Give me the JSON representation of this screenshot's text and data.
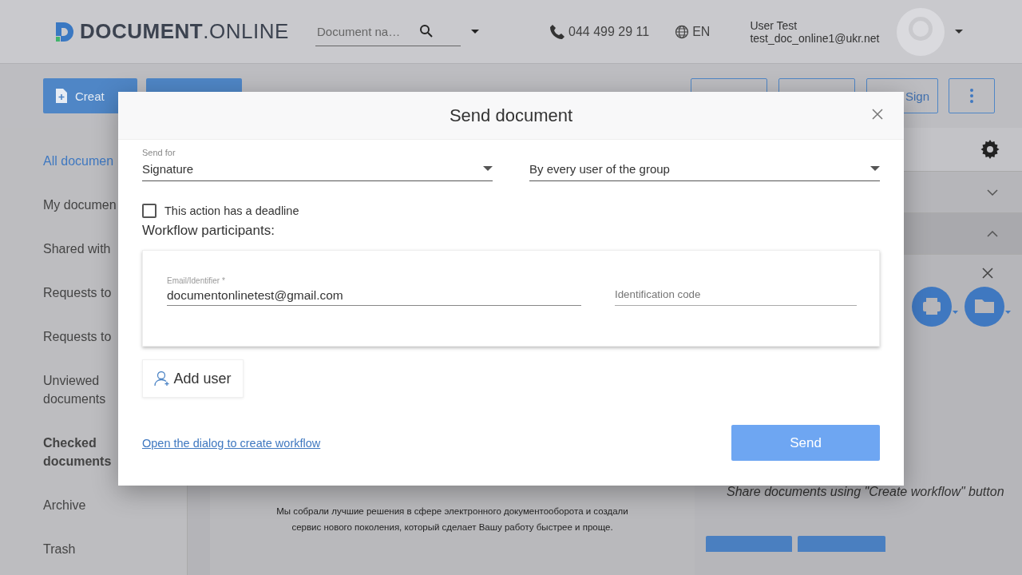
{
  "header": {
    "logo": "**DOCUMENT**.ONLINE",
    "search": {
      "placeholder": "Document na…"
    },
    "phone": "044 499 29 11",
    "language": "EN",
    "user": {
      "name": "User Test",
      "email": "test_doc_online1@ukr.net"
    }
  },
  "toolbar": {
    "left_buttons": [
      {
        "kind": "create",
        "label": "Creat"
      },
      {
        "kind": "blank"
      }
    ],
    "right_buttons": [
      {
        "kind": "outline"
      },
      {
        "kind": "outline"
      },
      {
        "kind": "sign",
        "label": "Sign"
      },
      {
        "kind": "more"
      }
    ]
  },
  "sidebar": {
    "items": [
      {
        "label": "All documen",
        "selected": true,
        "bold": false
      },
      {
        "label": "My documen",
        "selected": false,
        "bold": false
      },
      {
        "label": "Shared with",
        "selected": false,
        "bold": false
      },
      {
        "label": "Requests to",
        "selected": false,
        "bold": false
      },
      {
        "label": "Requests to",
        "selected": false,
        "bold": false
      },
      {
        "label": "Unviewed documents",
        "selected": false,
        "bold": false
      },
      {
        "label": "Checked documents",
        "selected": false,
        "bold": true
      },
      {
        "label": "Archive",
        "selected": false,
        "bold": false
      },
      {
        "label": "Trash",
        "selected": false,
        "bold": false
      }
    ]
  },
  "content": {
    "description": "Мы собрали лучшие решения в сфере электронного документооборота и создали сервис нового поколения, который сделает Вашу работу быстрее и проще."
  },
  "right_panel": {
    "sections": [
      {
        "expanded": false
      },
      {
        "expanded": true
      }
    ],
    "hint": "Share documents using \"Create workflow\" button"
  },
  "dialog": {
    "title": "Send document",
    "send_for": {
      "label": "Send for",
      "value": "Signature"
    },
    "mode": {
      "value": "By every user of the group"
    },
    "deadline": {
      "label": "This action has a deadline",
      "checked": false
    },
    "participants_label": "Workflow participants:",
    "participants": [
      {
        "email_label": "Email/Identifier *",
        "email": "documentonlinetest@gmail.com",
        "code_placeholder": "Identification code"
      }
    ],
    "add_user": "Add user",
    "workflow_link": "Open the dialog to create workflow",
    "send": "Send"
  }
}
